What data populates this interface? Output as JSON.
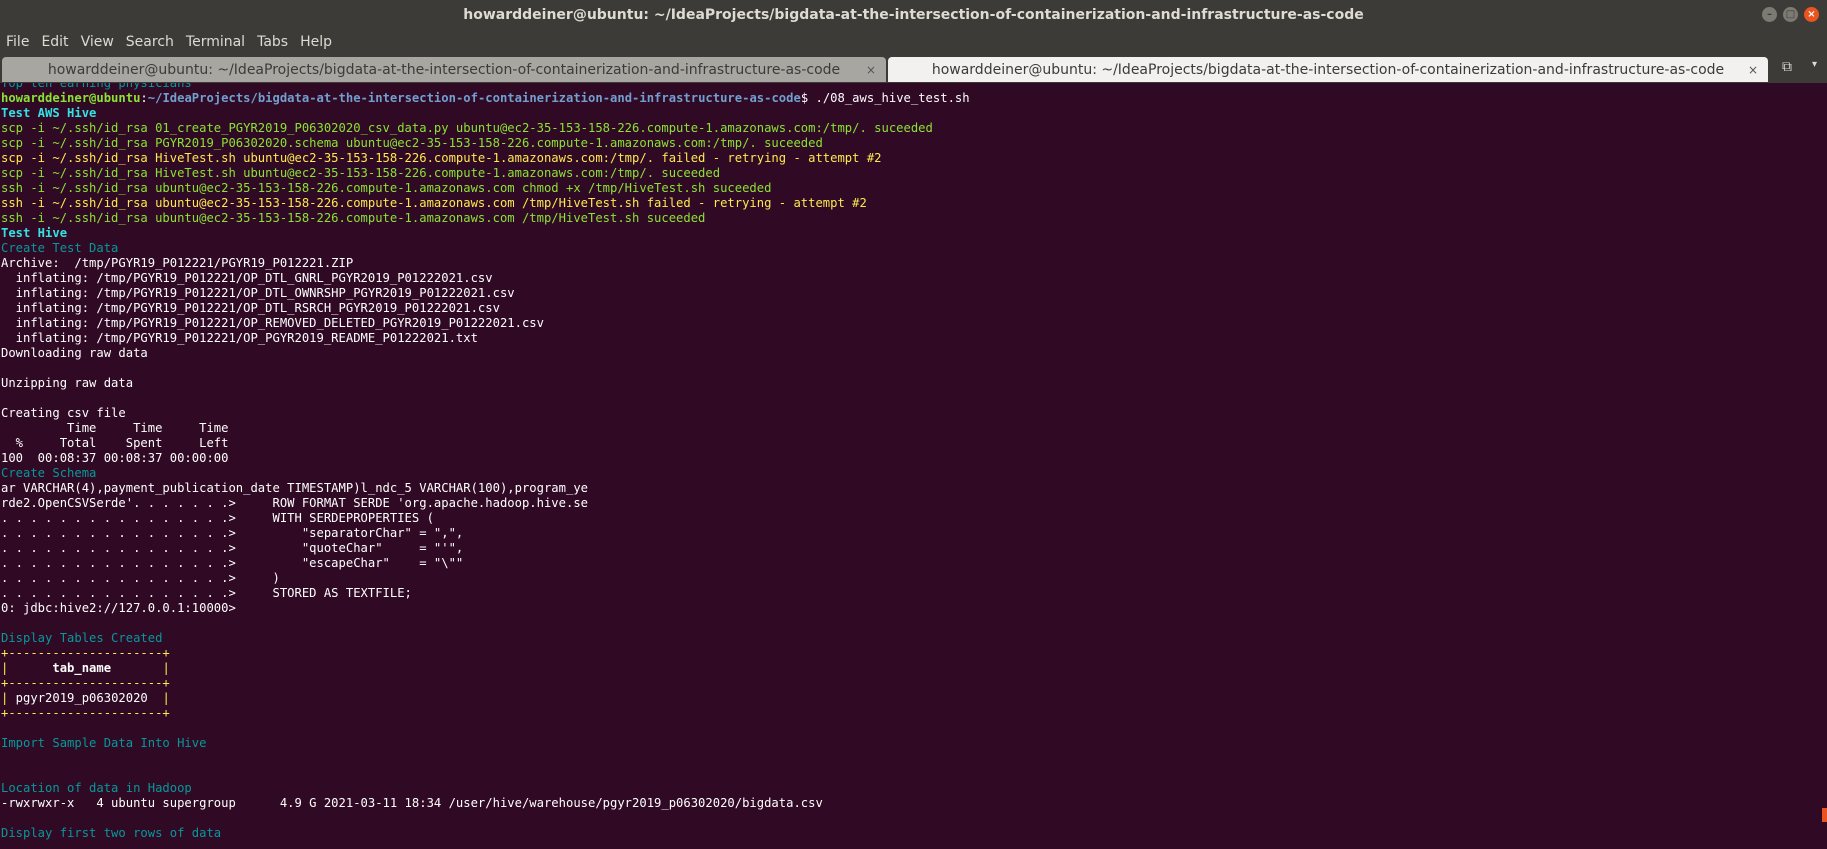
{
  "window": {
    "title": "howarddeiner@ubuntu: ~/IdeaProjects/bigdata-at-the-intersection-of-containerization-and-infrastructure-as-code",
    "controls": [
      "–",
      "□",
      "×"
    ]
  },
  "menu": [
    "File",
    "Edit",
    "View",
    "Search",
    "Terminal",
    "Tabs",
    "Help"
  ],
  "tabs": [
    {
      "label": "howarddeiner@ubuntu: ~/IdeaProjects/bigdata-at-the-intersection-of-containerization-and-infrastructure-as-code",
      "close": "×",
      "active": false
    },
    {
      "label": "howarddeiner@ubuntu: ~/IdeaProjects/bigdata-at-the-intersection-of-containerization-and-infrastructure-as-code",
      "close": "×",
      "active": true
    }
  ],
  "tab_extra": {
    "new_tab_icon": "⧉",
    "menu_icon": "▾"
  },
  "colors": {
    "background": "#300a24",
    "green": "#8ae234",
    "yellow": "#fce94f",
    "cyan": "#06989a",
    "bright_cyan": "#34e2e2",
    "prompt_blue": "#729fcf",
    "accent": "#e95420"
  },
  "terminal": {
    "partial_top": "Top ten earning physicians",
    "prompt": {
      "user": "howarddeiner@ubuntu",
      "sep": ":",
      "path": "~/IdeaProjects/bigdata-at-the-intersection-of-containerization-and-infrastructure-as-code",
      "dollar": "$",
      "command": " ./08_aws_hive_test.sh"
    },
    "lines": [
      {
        "text": "Test AWS Hive",
        "style": "cb"
      },
      {
        "text": "scp -i ~/.ssh/id_rsa 01_create_PGYR2019_P06302020_csv_data.py ubuntu@ec2-35-153-158-226.compute-1.amazonaws.com:/tmp/. suceeded",
        "style": "g"
      },
      {
        "text": "scp -i ~/.ssh/id_rsa PGYR2019_P06302020.schema ubuntu@ec2-35-153-158-226.compute-1.amazonaws.com:/tmp/. suceeded",
        "style": "g"
      },
      {
        "text": "scp -i ~/.ssh/id_rsa HiveTest.sh ubuntu@ec2-35-153-158-226.compute-1.amazonaws.com:/tmp/. failed - retrying - attempt #2",
        "style": "y"
      },
      {
        "text": "scp -i ~/.ssh/id_rsa HiveTest.sh ubuntu@ec2-35-153-158-226.compute-1.amazonaws.com:/tmp/. suceeded",
        "style": "g"
      },
      {
        "text": "ssh -i ~/.ssh/id_rsa ubuntu@ec2-35-153-158-226.compute-1.amazonaws.com chmod +x /tmp/HiveTest.sh suceeded",
        "style": "g"
      },
      {
        "text": "ssh -i ~/.ssh/id_rsa ubuntu@ec2-35-153-158-226.compute-1.amazonaws.com /tmp/HiveTest.sh failed - retrying - attempt #2",
        "style": "y"
      },
      {
        "text": "ssh -i ~/.ssh/id_rsa ubuntu@ec2-35-153-158-226.compute-1.amazonaws.com /tmp/HiveTest.sh suceeded",
        "style": "g"
      },
      {
        "text": "Test Hive",
        "style": "cb"
      },
      {
        "text": "Create Test Data",
        "style": "c"
      },
      {
        "text": "Archive:  /tmp/PGYR19_P012221/PGYR19_P012221.ZIP",
        "style": "w"
      },
      {
        "text": "  inflating: /tmp/PGYR19_P012221/OP_DTL_GNRL_PGYR2019_P01222021.csv",
        "style": "w"
      },
      {
        "text": "  inflating: /tmp/PGYR19_P012221/OP_DTL_OWNRSHP_PGYR2019_P01222021.csv",
        "style": "w"
      },
      {
        "text": "  inflating: /tmp/PGYR19_P012221/OP_DTL_RSRCH_PGYR2019_P01222021.csv",
        "style": "w"
      },
      {
        "text": "  inflating: /tmp/PGYR19_P012221/OP_REMOVED_DELETED_PGYR2019_P01222021.csv",
        "style": "w"
      },
      {
        "text": "  inflating: /tmp/PGYR19_P012221/OP_PGYR2019_README_P01222021.txt",
        "style": "w"
      },
      {
        "text": "Downloading raw data",
        "style": "w"
      },
      {
        "text": "",
        "style": "w"
      },
      {
        "text": "Unzipping raw data",
        "style": "w"
      },
      {
        "text": "",
        "style": "w"
      },
      {
        "text": "Creating csv file",
        "style": "w"
      },
      {
        "text": "         Time     Time     Time",
        "style": "w"
      },
      {
        "text": "  %     Total    Spent     Left",
        "style": "w"
      },
      {
        "text": "100  00:08:37 00:08:37 00:00:00",
        "style": "w"
      },
      {
        "text": "Create Schema",
        "style": "c"
      },
      {
        "text": "ar VARCHAR(4),payment_publication_date TIMESTAMP)l_ndc_5 VARCHAR(100),program_ye",
        "style": "w"
      },
      {
        "text": "rde2.OpenCSVSerde'. . . . . . .>     ROW FORMAT SERDE 'org.apache.hadoop.hive.se",
        "style": "w"
      },
      {
        "text": ". . . . . . . . . . . . . . . .>     WITH SERDEPROPERTIES (",
        "style": "w"
      },
      {
        "text": ". . . . . . . . . . . . . . . .>         \"separatorChar\" = \",\",",
        "style": "w"
      },
      {
        "text": ". . . . . . . . . . . . . . . .>         \"quoteChar\"     = \"'\",",
        "style": "w"
      },
      {
        "text": ". . . . . . . . . . . . . . . .>         \"escapeChar\"    = \"\\\"\"",
        "style": "w"
      },
      {
        "text": ". . . . . . . . . . . . . . . .>     )",
        "style": "w"
      },
      {
        "text": ". . . . . . . . . . . . . . . .>     STORED AS TEXTFILE;",
        "style": "w"
      },
      {
        "text": "0: jdbc:hive2://127.0.0.1:10000>",
        "style": "w"
      },
      {
        "text": "",
        "style": "w"
      },
      {
        "text": "Display Tables Created",
        "style": "c"
      },
      {
        "text": "+---------------------+",
        "style": "y"
      },
      {
        "text": "|      tab_name       |",
        "style": "y",
        "inner": "      tab_name       ",
        "inner_style": "bold"
      },
      {
        "text": "+---------------------+",
        "style": "y"
      },
      {
        "text": "| pgyr2019_p06302020  |",
        "style": "y",
        "inner": " pgyr2019_p06302020  ",
        "inner_style": "w"
      },
      {
        "text": "+---------------------+",
        "style": "y"
      },
      {
        "text": "",
        "style": "w"
      },
      {
        "text": "Import Sample Data Into Hive",
        "style": "c"
      },
      {
        "text": "",
        "style": "w"
      },
      {
        "text": "",
        "style": "w"
      },
      {
        "text": "Location of data in Hadoop",
        "style": "c"
      },
      {
        "text": "-rwxrwxr-x   4 ubuntu supergroup      4.9 G 2021-03-11 18:34 /user/hive/warehouse/pgyr2019_p06302020/bigdata.csv",
        "style": "w"
      },
      {
        "text": "",
        "style": "w"
      },
      {
        "text": "Display first two rows of data",
        "style": "c"
      }
    ]
  }
}
